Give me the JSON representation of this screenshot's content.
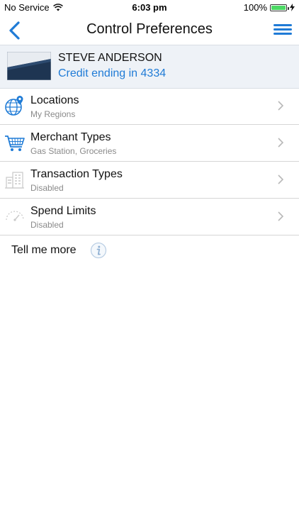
{
  "status_bar": {
    "carrier": "No Service",
    "time": "6:03 pm",
    "battery": "100%"
  },
  "nav": {
    "title": "Control Preferences",
    "back_icon": "chevron-left-icon",
    "menu_icon": "hamburger-menu-icon",
    "accent_color": "#1f7bd6"
  },
  "account": {
    "name": "STEVE ANDERSON",
    "subtitle": "Credit ending in 4334"
  },
  "preferences": [
    {
      "title": "Locations",
      "subtitle": "My Regions",
      "icon": "globe-location-icon"
    },
    {
      "title": "Merchant Types",
      "subtitle": "Gas Station, Groceries",
      "icon": "shopping-cart-icon"
    },
    {
      "title": "Transaction Types",
      "subtitle": "Disabled",
      "icon": "building-icon"
    },
    {
      "title": "Spend Limits",
      "subtitle": "Disabled",
      "icon": "gauge-icon"
    }
  ],
  "footer": {
    "tell_more": "Tell me more",
    "info_icon": "info-icon"
  }
}
